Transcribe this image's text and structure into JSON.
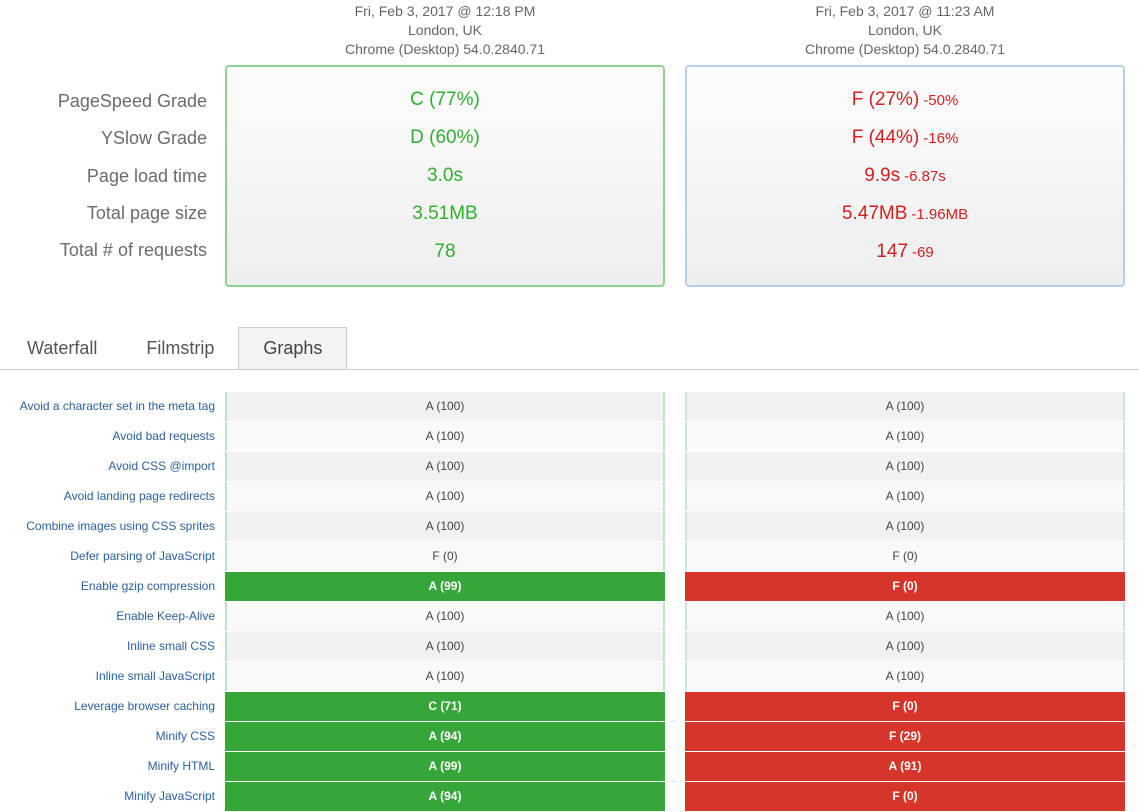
{
  "runs": {
    "left": {
      "timestamp": "Fri, Feb 3, 2017 @ 12:18 PM",
      "location": "London, UK",
      "browser": "Chrome (Desktop) 54.0.2840.71"
    },
    "right": {
      "timestamp": "Fri, Feb 3, 2017 @ 11:23 AM",
      "location": "London, UK",
      "browser": "Chrome (Desktop) 54.0.2840.71"
    }
  },
  "summary": {
    "labels": {
      "pagespeed": "PageSpeed Grade",
      "yslow": "YSlow Grade",
      "loadtime": "Page load time",
      "pagesize": "Total page size",
      "requests": "Total # of requests"
    },
    "left": {
      "pagespeed": "C (77%)",
      "yslow": "D (60%)",
      "loadtime": "3.0s",
      "pagesize": "3.51MB",
      "requests": "78"
    },
    "right": {
      "pagespeed": "F (27%)",
      "pagespeed_delta": "-50%",
      "yslow": "F (44%)",
      "yslow_delta": "-16%",
      "loadtime": "9.9s",
      "loadtime_delta": "-6.87s",
      "pagesize": "5.47MB",
      "pagesize_delta": "-1.96MB",
      "requests": "147",
      "requests_delta": "-69"
    }
  },
  "tabs": {
    "waterfall": "Waterfall",
    "filmstrip": "Filmstrip",
    "graphs": "Graphs"
  },
  "rules": [
    {
      "label": "Avoid a character set in the meta tag",
      "left": {
        "text": "A (100)",
        "state": "neutral"
      },
      "right": {
        "text": "A (100)",
        "state": "neutral"
      }
    },
    {
      "label": "Avoid bad requests",
      "left": {
        "text": "A (100)",
        "state": "neutral"
      },
      "right": {
        "text": "A (100)",
        "state": "neutral"
      }
    },
    {
      "label": "Avoid CSS @import",
      "left": {
        "text": "A (100)",
        "state": "neutral"
      },
      "right": {
        "text": "A (100)",
        "state": "neutral"
      }
    },
    {
      "label": "Avoid landing page redirects",
      "left": {
        "text": "A (100)",
        "state": "neutral"
      },
      "right": {
        "text": "A (100)",
        "state": "neutral"
      }
    },
    {
      "label": "Combine images using CSS sprites",
      "left": {
        "text": "A (100)",
        "state": "neutral"
      },
      "right": {
        "text": "A (100)",
        "state": "neutral"
      }
    },
    {
      "label": "Defer parsing of JavaScript",
      "left": {
        "text": "F (0)",
        "state": "neutral"
      },
      "right": {
        "text": "F (0)",
        "state": "neutral"
      }
    },
    {
      "label": "Enable gzip compression",
      "left": {
        "text": "A (99)",
        "state": "green"
      },
      "right": {
        "text": "F (0)",
        "state": "red"
      }
    },
    {
      "label": "Enable Keep-Alive",
      "left": {
        "text": "A (100)",
        "state": "neutral"
      },
      "right": {
        "text": "A (100)",
        "state": "neutral"
      }
    },
    {
      "label": "Inline small CSS",
      "left": {
        "text": "A (100)",
        "state": "neutral"
      },
      "right": {
        "text": "A (100)",
        "state": "neutral"
      }
    },
    {
      "label": "Inline small JavaScript",
      "left": {
        "text": "A (100)",
        "state": "neutral"
      },
      "right": {
        "text": "A (100)",
        "state": "neutral"
      }
    },
    {
      "label": "Leverage browser caching",
      "left": {
        "text": "C (71)",
        "state": "green"
      },
      "right": {
        "text": "F (0)",
        "state": "red"
      }
    },
    {
      "label": "Minify CSS",
      "left": {
        "text": "A (94)",
        "state": "green"
      },
      "right": {
        "text": "F (29)",
        "state": "red"
      }
    },
    {
      "label": "Minify HTML",
      "left": {
        "text": "A (99)",
        "state": "green"
      },
      "right": {
        "text": "A (91)",
        "state": "red"
      }
    },
    {
      "label": "Minify JavaScript",
      "left": {
        "text": "A (94)",
        "state": "green"
      },
      "right": {
        "text": "F (0)",
        "state": "red"
      }
    }
  ]
}
